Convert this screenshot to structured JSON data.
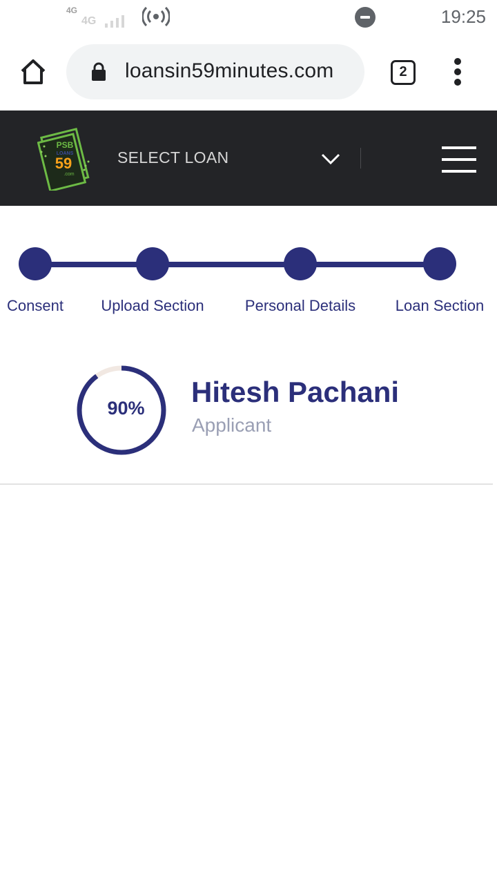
{
  "status_bar": {
    "network_type": "4G",
    "network_type_secondary": "4G",
    "time": "19:25",
    "icons": [
      "signal-icon",
      "hotspot-icon",
      "do-not-disturb-icon"
    ]
  },
  "browser": {
    "url": "loansin59minutes.com",
    "tab_count": "2",
    "icons": [
      "home-icon",
      "lock-icon",
      "tabs-icon",
      "more-vert-icon"
    ]
  },
  "header": {
    "logo_text_top": "PSB",
    "logo_text_mid": "LOANS",
    "logo_text_num": "59",
    "logo_text_bottom": ".com",
    "select_loan": "SELECT LOAN",
    "colors": {
      "background": "#232427",
      "logo_green": "#6dbb45",
      "logo_orange": "#f7a11a"
    }
  },
  "stepper": {
    "steps": [
      {
        "label": "Consent",
        "completed": true
      },
      {
        "label": "Upload Section",
        "completed": true
      },
      {
        "label": "Personal Details",
        "completed": true
      },
      {
        "label": "Loan Section",
        "completed": true
      }
    ],
    "color": "#2b2f7a"
  },
  "profile": {
    "progress_value": 0.9,
    "progress_text": "90%",
    "name": "Hitesh Pachani",
    "role": "Applicant",
    "colors": {
      "primary": "#2b2f7a",
      "track": "#f1e8e2",
      "role": "#9a9fb4"
    }
  }
}
